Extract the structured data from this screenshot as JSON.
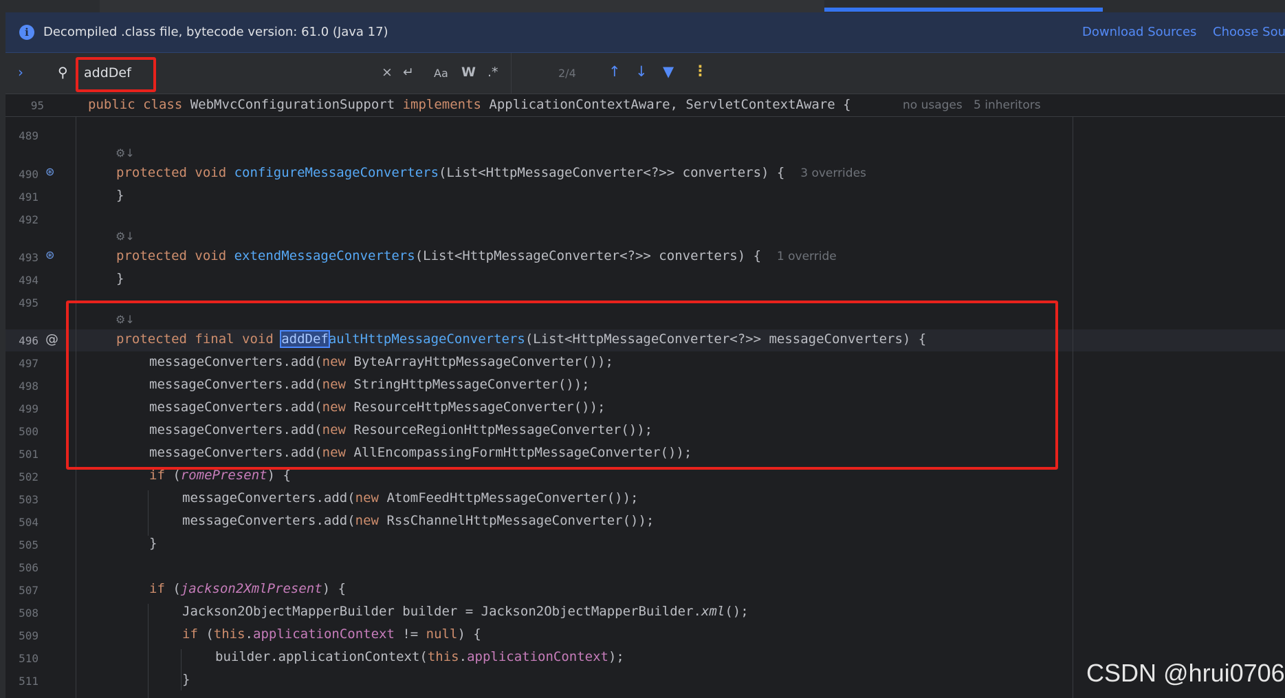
{
  "banner": {
    "message": "Decompiled .class file, bytecode version: 61.0 (Java 17)",
    "download_sources": "Download Sources",
    "choose_sources": "Choose Sourc"
  },
  "find": {
    "query": "addDef",
    "match_count": "2/4",
    "toggles": {
      "clear": "×",
      "newline": "↵",
      "case": "Aa",
      "words": "W",
      "regex": ".*"
    }
  },
  "header_line": {
    "number": "95",
    "text": "public class WebMvcConfigurationSupport implements ApplicationContextAware, ServletContextAware {",
    "usages": "no usages",
    "inheritors": "5 inheritors"
  },
  "line_numbers": [
    "489",
    "490",
    "491",
    "492",
    "493",
    "494",
    "495",
    "496",
    "497",
    "498",
    "499",
    "500",
    "501",
    "502",
    "503",
    "504",
    "505",
    "506",
    "507",
    "508",
    "509",
    "510",
    "511"
  ],
  "hints": {
    "configure_overrides": "3 overrides",
    "extend_override": "1 override"
  },
  "code": {
    "l490_sig": "configureMessageConverters",
    "l490_params": "(List<HttpMessageConverter<?>> converters) {",
    "l493_sig": "extendMessageConverters",
    "l493_params": "(List<HttpMessageConverter<?>> converters) {",
    "l496_match": "addDef",
    "l496_rest": "aultHttpMessageConverters",
    "l496_params": "(List<HttpMessageConverter<?>> messageConverters) {",
    "l497": "ByteArrayHttpMessageConverter());",
    "l498": "StringHttpMessageConverter());",
    "l499": "ResourceHttpMessageConverter());",
    "l500": "ResourceRegionHttpMessageConverter());",
    "l501": "AllEncompassingFormHttpMessageConverter());",
    "l502_field": "romePresent",
    "l503": "AtomFeedHttpMessageConverter());",
    "l504": "RssChannelHttpMessageConverter());",
    "l507_field": "jackson2XmlPresent",
    "l508_a": "Jackson2ObjectMapperBuilder builder = Jackson2ObjectMapperBuilder.",
    "l508_b": "xml",
    "l508_c": "();",
    "l509_field": "applicationContext",
    "l510_a": "builder.applicationContext(",
    "l510_field": "applicationContext",
    "l510_c": ");"
  },
  "watermark": "CSDN @hrui0706"
}
